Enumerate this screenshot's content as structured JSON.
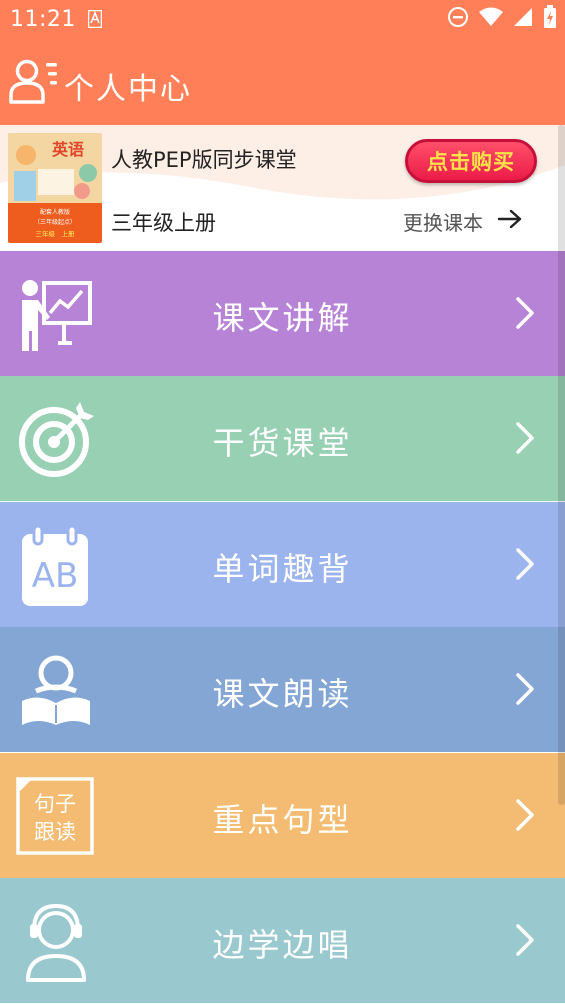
{
  "status_bar": {
    "time": "11:21"
  },
  "header": {
    "title": "个人中心"
  },
  "book": {
    "series": "人教PEP版同步课堂",
    "grade": "三年级上册",
    "buy_label": "点击购买",
    "change_label": "更换课本",
    "cover_title": "英语",
    "cover_line1": "配套人教版",
    "cover_line2": "（三年级起点）",
    "cover_line3": "三年级　上册"
  },
  "menu": [
    {
      "label": "课文讲解",
      "color": "#b783d7"
    },
    {
      "label": "干货课堂",
      "color": "#98d0b4"
    },
    {
      "label": "单词趣背",
      "color": "#9cb4ee"
    },
    {
      "label": "课文朗读",
      "color": "#83a6d4"
    },
    {
      "label": "重点句型",
      "color": "#f4bc72",
      "icon_text_line1": "句子",
      "icon_text_line2": "跟读"
    },
    {
      "label": "边学边唱",
      "color": "#99c8ce"
    }
  ],
  "icons": [
    "teacher-board-icon",
    "target-icon",
    "calendar-ab-icon",
    "reading-person-icon",
    "sentence-follow-icon",
    "headphone-person-icon"
  ],
  "colors": {
    "header": "#ff8058",
    "buy_button": "#ec1c48",
    "buy_text": "#ffe24a"
  }
}
